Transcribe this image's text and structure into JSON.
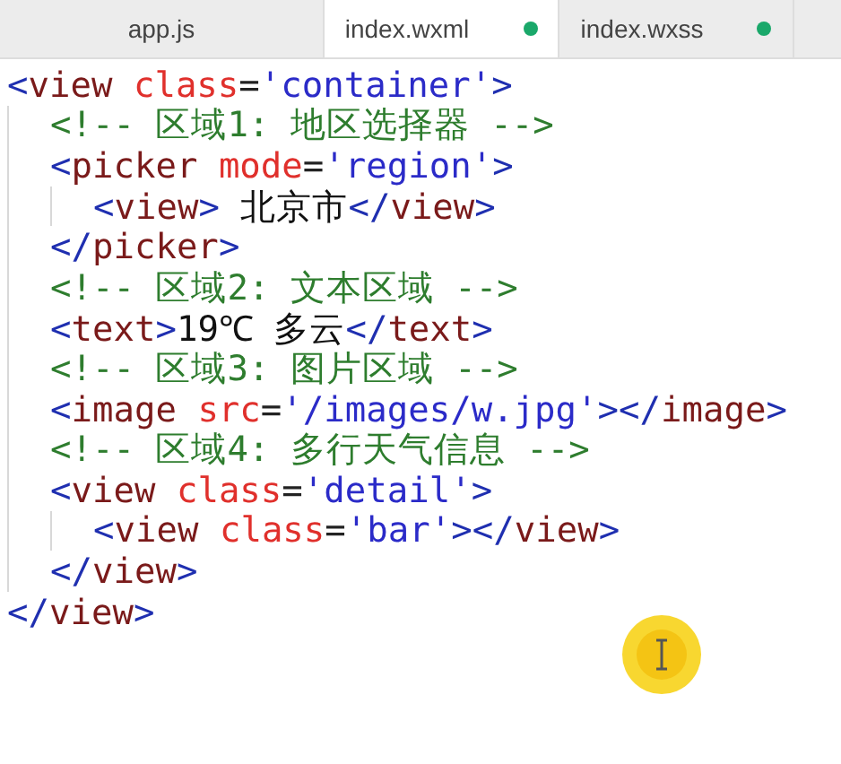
{
  "tabs": [
    {
      "label": "app.js",
      "selected": false,
      "modified": false
    },
    {
      "label": "index.wxml",
      "selected": true,
      "modified": true
    },
    {
      "label": "index.wxss",
      "selected": false,
      "modified": true
    }
  ],
  "code": [
    {
      "tokens": [
        {
          "kind": "bracket",
          "text": "<"
        },
        {
          "kind": "tag",
          "text": "view"
        },
        {
          "kind": "attr",
          "text": " class"
        },
        {
          "kind": "punct",
          "text": "="
        },
        {
          "kind": "value",
          "text": "'container'"
        },
        {
          "kind": "bracket",
          "text": ">"
        }
      ],
      "close": [
        {
          "kind": "bracket",
          "text": "</"
        },
        {
          "kind": "tag",
          "text": "view"
        },
        {
          "kind": "bracket",
          "text": ">"
        }
      ],
      "children": [
        {
          "tokens": [
            {
              "kind": "comment",
              "text": "<!-- 区域1: 地区选择器 -->"
            }
          ]
        },
        {
          "tokens": [
            {
              "kind": "bracket",
              "text": "<"
            },
            {
              "kind": "tag",
              "text": "picker"
            },
            {
              "kind": "attr",
              "text": " mode"
            },
            {
              "kind": "punct",
              "text": "="
            },
            {
              "kind": "value",
              "text": "'region'"
            },
            {
              "kind": "bracket",
              "text": ">"
            }
          ],
          "close": [
            {
              "kind": "bracket",
              "text": "</"
            },
            {
              "kind": "tag",
              "text": "picker"
            },
            {
              "kind": "bracket",
              "text": ">"
            }
          ],
          "children": [
            {
              "tokens": [
                {
                  "kind": "bracket",
                  "text": "<"
                },
                {
                  "kind": "tag",
                  "text": "view"
                },
                {
                  "kind": "bracket",
                  "text": ">"
                },
                {
                  "kind": "text",
                  "text": " 北京市"
                },
                {
                  "kind": "bracket",
                  "text": "</"
                },
                {
                  "kind": "tag",
                  "text": "view"
                },
                {
                  "kind": "bracket",
                  "text": ">"
                }
              ]
            }
          ]
        },
        {
          "tokens": [
            {
              "kind": "comment",
              "text": "<!-- 区域2: 文本区域 -->"
            }
          ]
        },
        {
          "tokens": [
            {
              "kind": "bracket",
              "text": "<"
            },
            {
              "kind": "tag",
              "text": "text"
            },
            {
              "kind": "bracket",
              "text": ">"
            },
            {
              "kind": "text",
              "text": "19℃ 多云"
            },
            {
              "kind": "bracket",
              "text": "</"
            },
            {
              "kind": "tag",
              "text": "text"
            },
            {
              "kind": "bracket",
              "text": ">"
            }
          ]
        },
        {
          "tokens": [
            {
              "kind": "comment",
              "text": "<!-- 区域3: 图片区域 -->"
            }
          ]
        },
        {
          "tokens": [
            {
              "kind": "bracket",
              "text": "<"
            },
            {
              "kind": "tag",
              "text": "image"
            },
            {
              "kind": "attr",
              "text": " src"
            },
            {
              "kind": "punct",
              "text": "="
            },
            {
              "kind": "value",
              "text": "'/images/w.jpg'"
            },
            {
              "kind": "bracket",
              "text": "></"
            },
            {
              "kind": "tag",
              "text": "image"
            },
            {
              "kind": "bracket",
              "text": ">"
            }
          ]
        },
        {
          "tokens": [
            {
              "kind": "comment",
              "text": "<!-- 区域4: 多行天气信息 -->"
            }
          ]
        },
        {
          "tokens": [
            {
              "kind": "bracket",
              "text": "<"
            },
            {
              "kind": "tag",
              "text": "view"
            },
            {
              "kind": "attr",
              "text": " class"
            },
            {
              "kind": "punct",
              "text": "="
            },
            {
              "kind": "value",
              "text": "'detail'"
            },
            {
              "kind": "bracket",
              "text": ">"
            }
          ],
          "close": [
            {
              "kind": "bracket",
              "text": "</"
            },
            {
              "kind": "tag",
              "text": "view"
            },
            {
              "kind": "bracket",
              "text": ">"
            }
          ],
          "children": [
            {
              "tokens": [
                {
                  "kind": "bracket",
                  "text": "<"
                },
                {
                  "kind": "tag",
                  "text": "view"
                },
                {
                  "kind": "attr",
                  "text": " class"
                },
                {
                  "kind": "punct",
                  "text": "="
                },
                {
                  "kind": "value",
                  "text": "'bar'"
                },
                {
                  "kind": "bracket",
                  "text": "></"
                },
                {
                  "kind": "tag",
                  "text": "view"
                },
                {
                  "kind": "bracket",
                  "text": ">"
                }
              ]
            }
          ]
        }
      ]
    }
  ]
}
